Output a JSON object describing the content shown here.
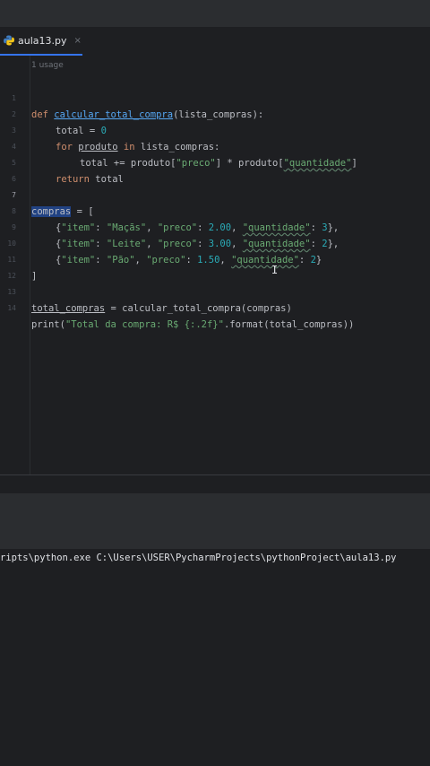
{
  "tab": {
    "filename": "aula13.py",
    "close": "×"
  },
  "editor": {
    "usage_hint": "1 usage",
    "lines": [
      {
        "n": "1"
      },
      {
        "n": "2"
      },
      {
        "n": "3"
      },
      {
        "n": "4"
      },
      {
        "n": "5"
      },
      {
        "n": "6"
      },
      {
        "n": "7"
      },
      {
        "n": "8"
      },
      {
        "n": "9"
      },
      {
        "n": "10"
      },
      {
        "n": "11"
      },
      {
        "n": "12"
      },
      {
        "n": "13"
      },
      {
        "n": "14"
      }
    ],
    "code": {
      "l1_def": "def",
      "l1_name": "calcular_total_compra",
      "l1_rest": "(lista_compras):",
      "l2": "total = ",
      "l2_num": "0",
      "l3_for": "for",
      "l3_var": "produto",
      "l3_in": "in",
      "l3_rest": " lista_compras:",
      "l4_a": "total += produto[",
      "l4_s1": "\"preco\"",
      "l4_b": "] * produto[",
      "l4_s2": "\"quantidade\"",
      "l4_c": "]",
      "l5_ret": "return",
      "l5_rest": " total",
      "l7_var": "compras",
      "l7_rest": " = [",
      "l8": [
        "{",
        "\"item\"",
        ": ",
        "\"Maçãs\"",
        ", ",
        "\"preco\"",
        ": ",
        "2.00",
        ", ",
        "\"quantidade\"",
        ": ",
        "3",
        "},"
      ],
      "l9": [
        "{",
        "\"item\"",
        ": ",
        "\"Leite\"",
        ", ",
        "\"preco\"",
        ": ",
        "3.00",
        ", ",
        "\"quantidade\"",
        ": ",
        "2",
        "},"
      ],
      "l10": [
        "{",
        "\"item\"",
        ": ",
        "\"Pão\"",
        ", ",
        "\"preco\"",
        ": ",
        "1.50",
        ", ",
        "\"quantidade\"",
        ": ",
        "2",
        "}"
      ],
      "l11": "]",
      "l13_var": "total_compras",
      "l13_rest": " = calcular_total_compra(compras)",
      "l14_a": "print(",
      "l14_s": "\"Total da compra: R$ {:.2f}\"",
      "l14_b": ".format(total_compras))"
    }
  },
  "console": {
    "output": "ripts\\python.exe C:\\Users\\USER\\PycharmProjects\\pythonProject\\aula13.py"
  }
}
